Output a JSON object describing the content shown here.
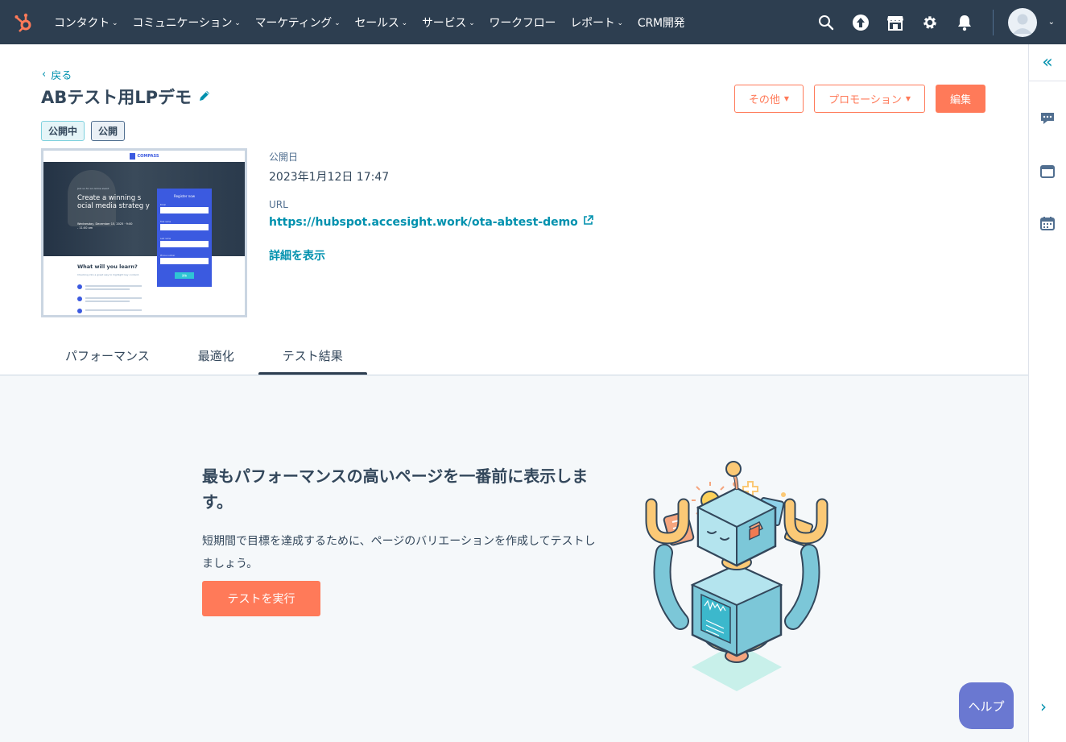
{
  "nav": {
    "items": [
      {
        "label": "コンタクト",
        "chevron": true
      },
      {
        "label": "コミュニケーション",
        "chevron": true
      },
      {
        "label": "マーケティング",
        "chevron": true
      },
      {
        "label": "セールス",
        "chevron": true
      },
      {
        "label": "サービス",
        "chevron": true
      },
      {
        "label": "ワークフロー",
        "chevron": false
      },
      {
        "label": "レポート",
        "chevron": true
      },
      {
        "label": "CRM開発",
        "chevron": false
      }
    ],
    "chevron_glyph": "⌄"
  },
  "page": {
    "back_label": "戻る",
    "title": "ABテスト用LPデモ",
    "badges": [
      "公開中",
      "公開"
    ],
    "actions": {
      "more_label": "その他",
      "promotion_label": "プロモーション",
      "edit_label": "編集"
    }
  },
  "preview": {
    "brand": "COMPASS",
    "eyebrow": "Join us for an online event",
    "headline": "Create a winning s ocial media strateg y",
    "date": "Wednesday, December 15, 2025 · 9:00 - 11:00 am",
    "form_title": "Register now",
    "form_fields": [
      "Email",
      "First name",
      "Last name",
      "Phone number"
    ],
    "submit": "送信",
    "section_title": "What will you learn?",
    "section_body": "Checking into a great way to highlight key content."
  },
  "meta": {
    "published_label": "公開日",
    "published_value": "2023年1月12日 17:47",
    "url_label": "URL",
    "url_value": "https://hubspot.accesight.work/ota-abtest-demo",
    "details_label": "詳細を表示"
  },
  "tabs": [
    {
      "label": "パフォーマンス",
      "active": false
    },
    {
      "label": "最適化",
      "active": false
    },
    {
      "label": "テスト結果",
      "active": true
    }
  ],
  "empty_state": {
    "heading": "最もパフォーマンスの高いページを一番前に表示します。",
    "body": "短期間で目標を達成するために、ページのバリエーションを作成してテストしましょう。",
    "button": "テストを実行"
  },
  "help_label": "ヘルプ",
  "colors": {
    "nav_bg": "#2d3e50",
    "accent": "#ff7a59",
    "link": "#0091ae",
    "help": "#6a78d1",
    "panel_bg": "#f5f8fa"
  }
}
